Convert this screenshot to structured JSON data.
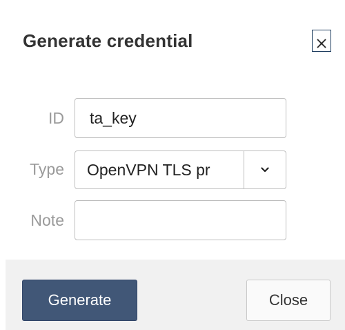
{
  "dialog": {
    "title": "Generate credential",
    "close_icon": "close-icon"
  },
  "form": {
    "id": {
      "label": "ID",
      "value": "ta_key"
    },
    "type": {
      "label": "Type",
      "selected": "OpenVPN TLS pr",
      "caret_icon": "chevron-down-icon"
    },
    "note": {
      "label": "Note",
      "value": ""
    }
  },
  "footer": {
    "generate_label": "Generate",
    "close_label": "Close"
  },
  "colors": {
    "primary_button": "#415777",
    "footer_bg": "#f1f1f1",
    "label_text": "#9a9a9a",
    "title_text": "#333333"
  }
}
